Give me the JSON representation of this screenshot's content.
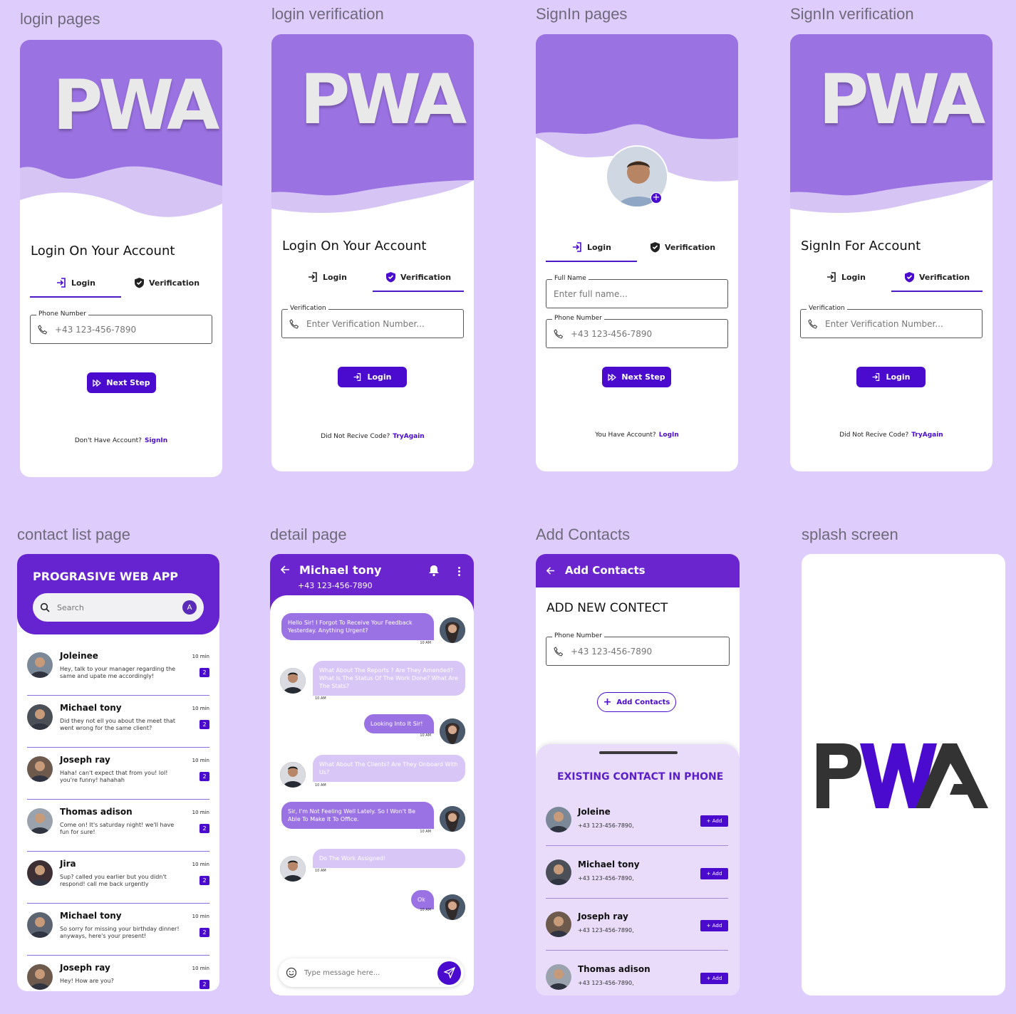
{
  "sections": {
    "login": "login pages",
    "login_verification": "login verification",
    "signin": "SignIn pages",
    "signin_verification": "SignIn verification",
    "contact_list": "contact list page",
    "detail": "detail page",
    "add_contacts": "Add Contacts",
    "splash": "splash screen"
  },
  "logo": {
    "text": "PWA"
  },
  "login_page": {
    "heading": "Login On Your Account",
    "tab_login": "Login",
    "tab_verification": "Verification",
    "field_label": "Phone Number",
    "field_placeholder": "+43 123-456-7890",
    "button": "Next Step",
    "footer_text": "Don't Have Account?",
    "footer_link": "SignIn"
  },
  "login_verification_page": {
    "heading": "Login On Your Account",
    "tab_login": "Login",
    "tab_verification": "Verification",
    "field_label": "Verification",
    "field_placeholder": "Enter Verification Number...",
    "button": "Login",
    "footer_text": "Did Not Recive Code?",
    "footer_link": "TryAgain"
  },
  "signin_page": {
    "tab_login": "Login",
    "tab_verification": "Verification",
    "name_label": "Full Name",
    "name_placeholder": "Enter full name...",
    "phone_label": "Phone Number",
    "phone_placeholder": "+43 123-456-7890",
    "button": "Next Step",
    "footer_text": "You Have  Account?",
    "footer_link": "LogIn"
  },
  "signin_verification_page": {
    "heading": "SignIn For Account",
    "tab_login": "Login",
    "tab_verification": "Verification",
    "field_label": "Verification",
    "field_placeholder": "Enter Verification Number...",
    "button": "Login",
    "footer_text": "Did Not Recive Code?",
    "footer_link": "TryAgain"
  },
  "contact_list_page": {
    "title": "PROGRASIVE WEB APP",
    "search_placeholder": "Search",
    "avatar_letter": "A",
    "contacts": [
      {
        "name": "Joleinee",
        "message": "Hey, talk to your manager regarding the same and upate me accordingly!",
        "time": "10 min",
        "badge": "2"
      },
      {
        "name": "Michael tony",
        "message": "Did they not ell you about the meet that went wrong for the same client?",
        "time": "10 min",
        "badge": "2"
      },
      {
        "name": "Joseph ray",
        "message": "Haha! can't expect that from you! lol! you're funny! hahahah",
        "time": "10 min",
        "badge": "2"
      },
      {
        "name": "Thomas adison",
        "message": "Come on! It's saturday night! we'll have fun for sure!",
        "time": "10 min",
        "badge": "2"
      },
      {
        "name": "Jira",
        "message": "Sup? called you earlier but you didn't respond! call me back urgently",
        "time": "10 min",
        "badge": "2"
      },
      {
        "name": "Michael tony",
        "message": "So sorry for missing your birthday dinner! anyways, here's your present!",
        "time": "10 min",
        "badge": "2"
      },
      {
        "name": "Joseph ray",
        "message": "Hey! How are you?",
        "time": "10 min",
        "badge": "2"
      }
    ]
  },
  "detail_page": {
    "name": "Michael tony",
    "phone": "+43 123-456-7890",
    "messages": [
      {
        "text": "Hello Sir! I Forgot To Receive Your Feedback Yesterday. Anything Urgent?",
        "time": "10 AM",
        "from": "me"
      },
      {
        "text": "What About The Reports ? Are They Amended? What Is The Status Of The Work Done? What Are The Stats?",
        "time": "10 AM",
        "from": "them"
      },
      {
        "text": "Looking Into It Sir!",
        "time": "10 AM",
        "from": "me"
      },
      {
        "text": "What About The Clients? Are They Onboard With Us?",
        "time": "10 AM",
        "from": "them"
      },
      {
        "text": "Sir, I'm Not Feeling Well Lately. So I Won't  Be Able To Make It To Office.",
        "time": "10 AM",
        "from": "me"
      },
      {
        "text": "Do The Work Assigned!",
        "time": "10 AM",
        "from": "them"
      },
      {
        "text": "Ok",
        "time": "10 AM",
        "from": "me"
      }
    ],
    "input_placeholder": "Type message here..."
  },
  "add_contacts_page": {
    "title": "Add Contacts",
    "heading": "ADD NEW CONTECT",
    "field_label": "Phone Number",
    "field_placeholder": "+43 123-456-7890",
    "button": "Add Contacts",
    "existing_title": "EXISTING CONTACT IN PHONE",
    "add_label": "+ Add",
    "contacts": [
      {
        "name": "Joleine",
        "phone": "+43 123-456-7890,"
      },
      {
        "name": "Michael tony",
        "phone": "+43 123-456-7890,"
      },
      {
        "name": "Joseph ray",
        "phone": "+43 123-456-7890,"
      },
      {
        "name": "Thomas adison",
        "phone": "+43 123-456-7890,"
      }
    ]
  },
  "colors": {
    "accent": "#4a0bcf",
    "header_purple": "#9b72e2",
    "page_bg": "#ddccfc"
  }
}
